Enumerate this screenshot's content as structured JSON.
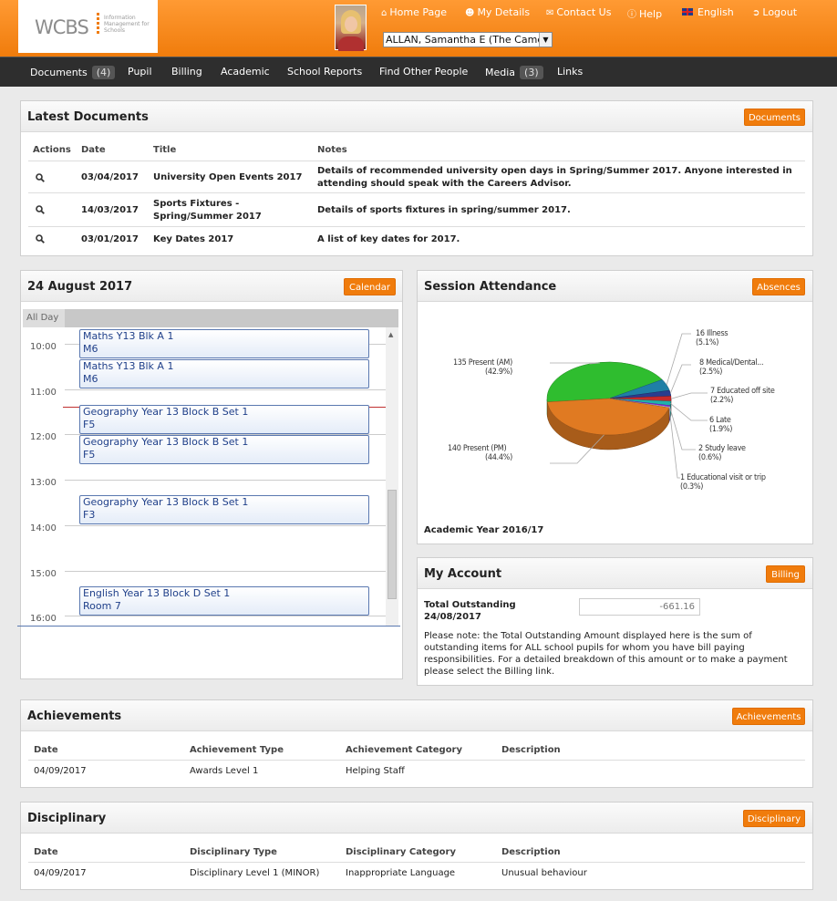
{
  "header": {
    "logo_text": "WCBS",
    "logo_sub": "Information Management for Schools",
    "links": {
      "home": "Home Page",
      "details": "My Details",
      "contact": "Contact Us",
      "help": "Help",
      "language": "English",
      "logout": "Logout"
    },
    "user_select": "ALLAN, Samantha E (The Camelo"
  },
  "nav": {
    "documents": "Documents",
    "documents_count": "(4)",
    "pupil": "Pupil",
    "billing": "Billing",
    "academic": "Academic",
    "school_reports": "School Reports",
    "find_people": "Find Other People",
    "media": "Media",
    "media_count": "(3)",
    "links": "Links"
  },
  "latest_documents": {
    "title": "Latest Documents",
    "button": "Documents",
    "headers": [
      "Actions",
      "Date",
      "Title",
      "Notes"
    ],
    "rows": [
      {
        "date": "03/04/2017",
        "title": "University Open Events 2017",
        "notes": "Details of recommended university open days in Spring/Summer 2017. Anyone interested in attending should speak with the Careers Advisor."
      },
      {
        "date": "14/03/2017",
        "title": "Sports Fixtures - Spring/Summer 2017",
        "notes": "Details of sports fixtures in spring/summer 2017."
      },
      {
        "date": "03/01/2017",
        "title": "Key Dates 2017",
        "notes": "A list of key dates for 2017."
      }
    ]
  },
  "calendar": {
    "title": "24 August 2017",
    "button": "Calendar",
    "all_day": "All Day",
    "hours": [
      "10:00",
      "11:00",
      "12:00",
      "13:00",
      "14:00",
      "15:00",
      "16:00"
    ],
    "events": [
      {
        "line1": "Maths Y13 Blk A 1",
        "line2": "M6"
      },
      {
        "line1": "Maths Y13 Blk A 1",
        "line2": "M6"
      },
      {
        "line1": "Geography Year 13 Block B Set 1",
        "line2": "F5"
      },
      {
        "line1": "Geography Year 13 Block B Set 1",
        "line2": "F5"
      },
      {
        "line1": "Geography Year 13 Block B Set 1",
        "line2": "F3"
      },
      {
        "line1": "English Year 13 Block D Set 1",
        "line2": "Room 7"
      }
    ]
  },
  "attendance": {
    "title": "Session Attendance",
    "button": "Absences",
    "footer": "Academic Year 2016/17",
    "labels": [
      {
        "name": "135 Present (AM)",
        "pct": "(42.9%)"
      },
      {
        "name": "140 Present (PM)",
        "pct": "(44.4%)"
      },
      {
        "name": "16 Illness",
        "pct": "(5.1%)"
      },
      {
        "name": "8 Medical/Dental...",
        "pct": "(2.5%)"
      },
      {
        "name": "7 Educated off site",
        "pct": "(2.2%)"
      },
      {
        "name": "6 Late",
        "pct": "(1.9%)"
      },
      {
        "name": "2 Study leave",
        "pct": "(0.6%)"
      },
      {
        "name": "1 Educational visit or trip",
        "pct": "(0.3%)"
      }
    ]
  },
  "chart_data": {
    "type": "pie",
    "categories": [
      "Present (AM)",
      "Present (PM)",
      "Illness",
      "Medical/Dental...",
      "Educated off site",
      "Late",
      "Study leave",
      "Educational visit or trip"
    ],
    "values": [
      135,
      140,
      16,
      8,
      7,
      6,
      2,
      1
    ],
    "percentages": [
      42.9,
      44.4,
      5.1,
      2.5,
      2.2,
      1.9,
      0.6,
      0.3
    ],
    "colors": [
      "#2fbd2f",
      "#e07a22",
      "#1f7fa6",
      "#2a3d8f",
      "#c82a2a",
      "#20b2aa",
      "#8a2be2",
      "#e6e6e6"
    ]
  },
  "account": {
    "title": "My Account",
    "button": "Billing",
    "label1": "Total Outstanding",
    "label2": "24/08/2017",
    "amount": "-661.16",
    "note": "Please note: the Total Outstanding Amount displayed here is the sum of outstanding items for ALL school pupils for whom you have bill paying responsibilities. For a detailed breakdown of this amount or to make a payment please select the Billing link."
  },
  "achievements": {
    "title": "Achievements",
    "button": "Achievements",
    "headers": [
      "Date",
      "Achievement Type",
      "Achievement Category",
      "Description"
    ],
    "row": [
      "04/09/2017",
      "Awards Level 1",
      "Helping Staff",
      ""
    ]
  },
  "disciplinary": {
    "title": "Disciplinary",
    "button": "Disciplinary",
    "headers": [
      "Date",
      "Disciplinary Type",
      "Disciplinary Category",
      "Description"
    ],
    "row": [
      "04/09/2017",
      "Disciplinary Level 1 (MINOR)",
      "Inappropriate Language",
      "Unusual behaviour"
    ]
  }
}
